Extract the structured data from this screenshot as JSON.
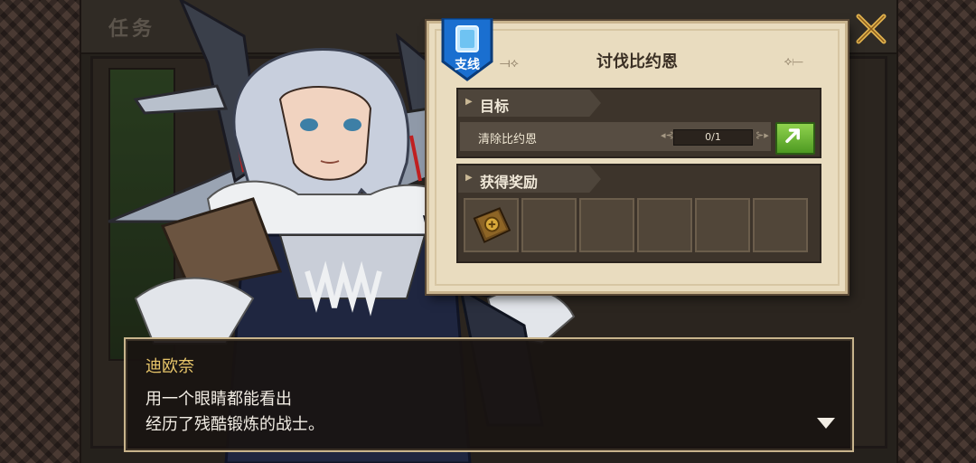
{
  "screen": {
    "background_title": "任务"
  },
  "quest": {
    "category_label": "支线",
    "title": "讨伐比约恩",
    "goal_header": "目标",
    "goal_text": "清除比约恩",
    "progress_text": "0/1",
    "progress": {
      "current": 0,
      "total": 1
    },
    "reward_header": "获得奖励",
    "rewards": [
      {
        "icon": "book-icon",
        "filled": true
      },
      {
        "icon": "",
        "filled": false
      },
      {
        "icon": "",
        "filled": false
      },
      {
        "icon": "",
        "filled": false
      },
      {
        "icon": "",
        "filled": false
      },
      {
        "icon": "",
        "filled": false
      }
    ]
  },
  "dialog": {
    "speaker": "迪欧奈",
    "lines": [
      "用一个眼睛都能看出",
      "经历了残酷锻炼的战士。"
    ]
  },
  "colors": {
    "panel_bg": "#e9dcbf",
    "section_bg": "#3d342b",
    "go_button": "#6cbd34",
    "speaker_name": "#e8c66a",
    "badge_blue": "#1a6fd0"
  },
  "icons": {
    "close": "close-icon",
    "go": "arrow-up-right-icon",
    "next": "triangle-down-icon",
    "badge": "card-icon"
  }
}
